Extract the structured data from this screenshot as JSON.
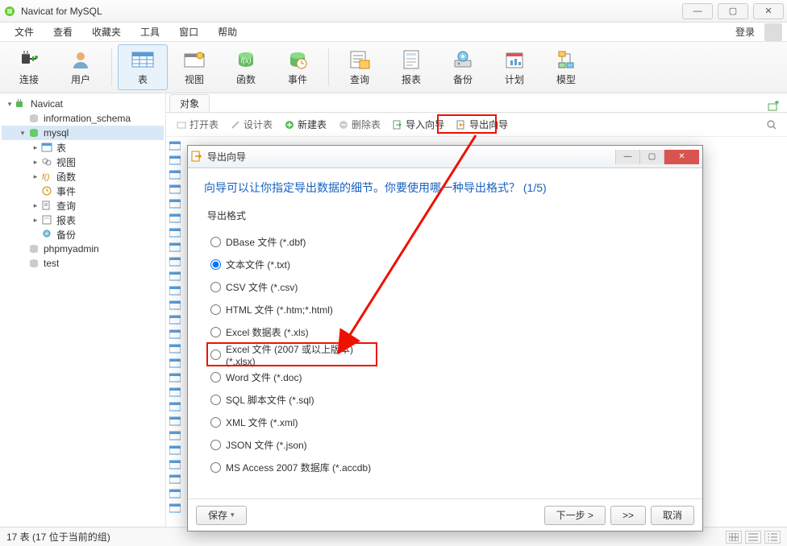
{
  "app": {
    "title": "Navicat for MySQL"
  },
  "menu": {
    "items": [
      "文件",
      "查看",
      "收藏夹",
      "工具",
      "窗口",
      "帮助"
    ],
    "login": "登录"
  },
  "toolbar": {
    "items": [
      {
        "label": "连接",
        "icon": "plug"
      },
      {
        "label": "用户",
        "icon": "user"
      },
      {
        "label": "表",
        "icon": "table",
        "active": true
      },
      {
        "label": "视图",
        "icon": "view"
      },
      {
        "label": "函数",
        "icon": "fx"
      },
      {
        "label": "事件",
        "icon": "event"
      },
      {
        "label": "查询",
        "icon": "query"
      },
      {
        "label": "报表",
        "icon": "report"
      },
      {
        "label": "备份",
        "icon": "backup"
      },
      {
        "label": "计划",
        "icon": "schedule"
      },
      {
        "label": "模型",
        "icon": "model"
      }
    ]
  },
  "tree": [
    {
      "level": 0,
      "arrow": "▾",
      "icon": "conn",
      "label": "Navicat"
    },
    {
      "level": 1,
      "arrow": "",
      "icon": "db-off",
      "label": "information_schema"
    },
    {
      "level": 1,
      "arrow": "▾",
      "icon": "db-on",
      "label": "mysql",
      "selected": true
    },
    {
      "level": 2,
      "arrow": "▸",
      "icon": "tables",
      "label": "表"
    },
    {
      "level": 2,
      "arrow": "▸",
      "icon": "views",
      "label": "视图"
    },
    {
      "level": 2,
      "arrow": "▸",
      "icon": "fx",
      "label": "函数"
    },
    {
      "level": 2,
      "arrow": "",
      "icon": "event",
      "label": "事件"
    },
    {
      "level": 2,
      "arrow": "▸",
      "icon": "query",
      "label": "查询"
    },
    {
      "level": 2,
      "arrow": "▸",
      "icon": "report",
      "label": "报表"
    },
    {
      "level": 2,
      "arrow": "",
      "icon": "backup",
      "label": "备份"
    },
    {
      "level": 1,
      "arrow": "",
      "icon": "db-off",
      "label": "phpmyadmin"
    },
    {
      "level": 1,
      "arrow": "",
      "icon": "db-off",
      "label": "test"
    }
  ],
  "tab": {
    "label": "对象"
  },
  "subtoolbar": {
    "open": "打开表",
    "design": "设计表",
    "new": "新建表",
    "delete": "删除表",
    "import": "导入向导",
    "export": "导出向导"
  },
  "dialog": {
    "title": "导出向导",
    "heading": "向导可以让你指定导出数据的细节。你要使用哪一种导出格式？ (1/5)",
    "group_label": "导出格式",
    "options": [
      "DBase 文件 (*.dbf)",
      "文本文件 (*.txt)",
      "CSV 文件 (*.csv)",
      "HTML 文件 (*.htm;*.html)",
      "Excel 数据表 (*.xls)",
      "Excel 文件 (2007 或以上版本) (*.xlsx)",
      "Word 文件 (*.doc)",
      "SQL 脚本文件 (*.sql)",
      "XML 文件 (*.xml)",
      "JSON 文件 (*.json)",
      "MS Access 2007 数据库 (*.accdb)"
    ],
    "selected_index": 1,
    "highlight_index": 5,
    "buttons": {
      "save": "保存",
      "next": "下一步 >",
      "skip": ">>",
      "cancel": "取消"
    }
  },
  "status": {
    "text": "17 表 (17 位于当前的组)"
  }
}
